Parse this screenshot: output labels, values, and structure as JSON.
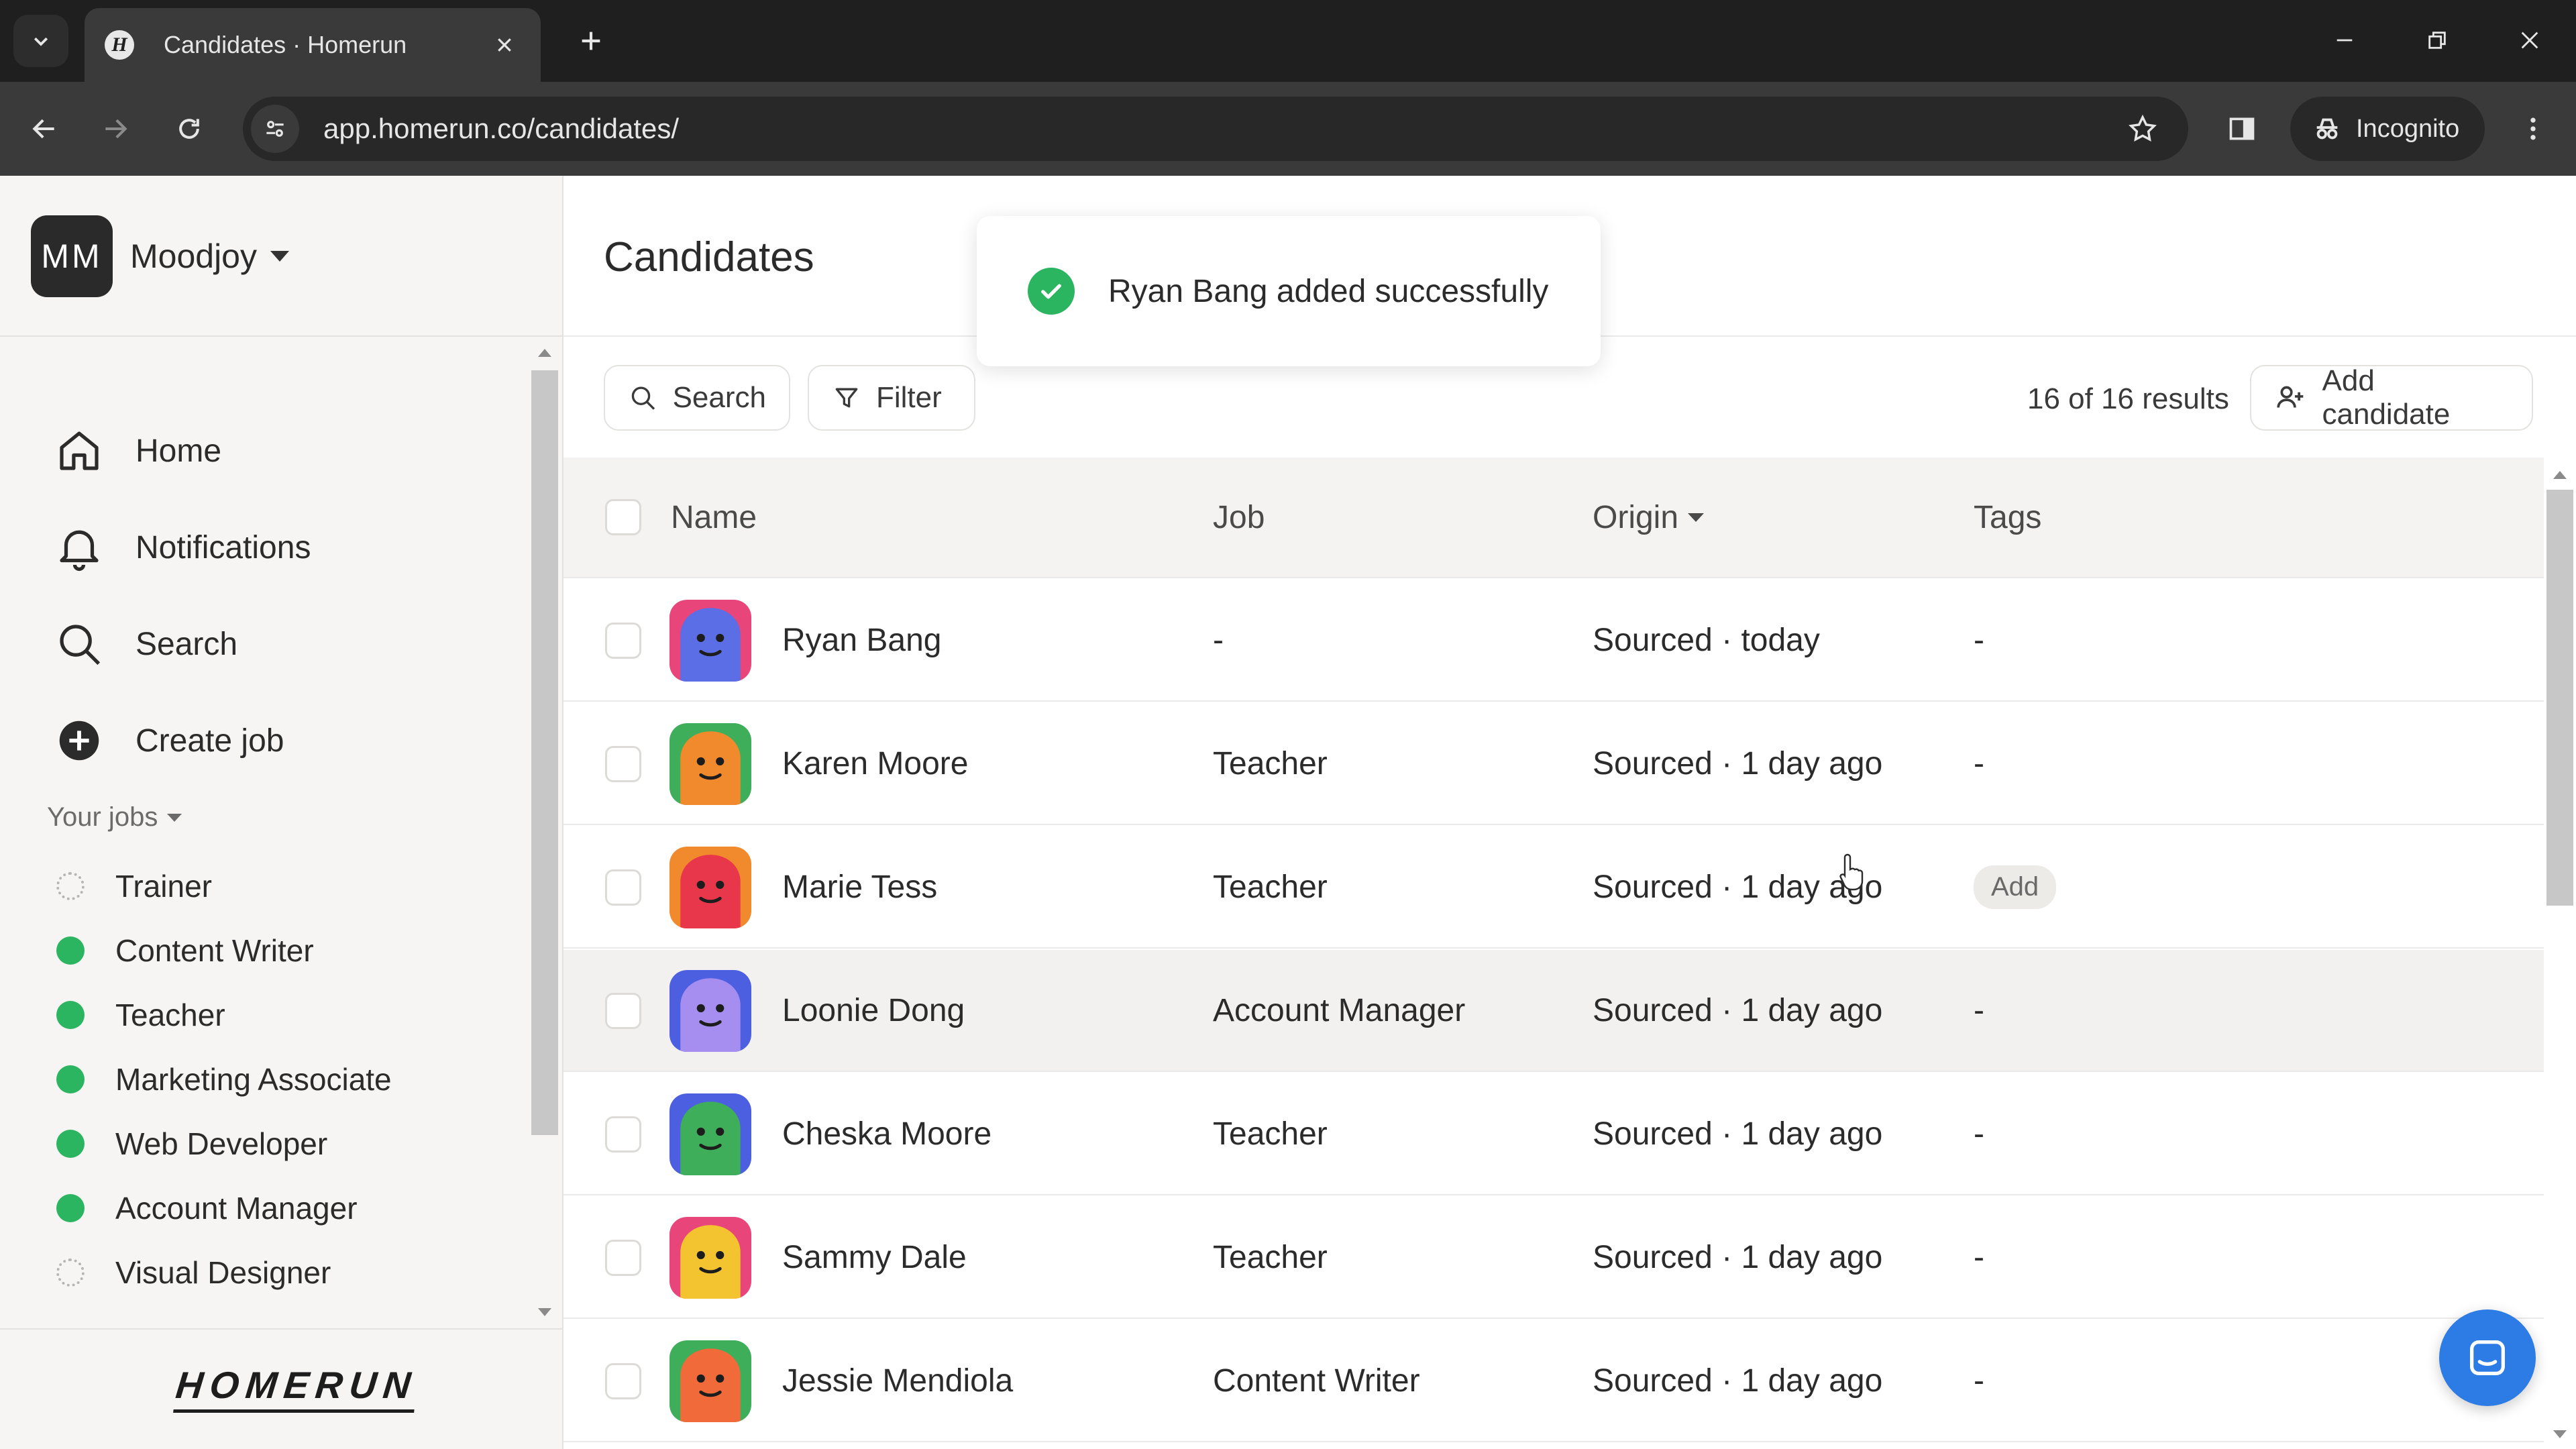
{
  "browser": {
    "tab_title": "Candidates · Homerun",
    "favicon_letter": "H",
    "url": "app.homerun.co/candidates/",
    "incognito_label": "Incognito"
  },
  "sidebar": {
    "org_initials": "MM",
    "org_name": "Moodjoy",
    "nav": [
      {
        "label": "Home",
        "icon": "home-icon"
      },
      {
        "label": "Notifications",
        "icon": "bell-icon"
      },
      {
        "label": "Search",
        "icon": "search-icon"
      },
      {
        "label": "Create job",
        "icon": "plus-circle-icon"
      }
    ],
    "jobs_header": "Your jobs",
    "jobs": [
      {
        "label": "Trainer",
        "status": "draft"
      },
      {
        "label": "Content Writer",
        "status": "published"
      },
      {
        "label": "Teacher",
        "status": "published"
      },
      {
        "label": "Marketing Associate",
        "status": "published"
      },
      {
        "label": "Web Developer",
        "status": "published"
      },
      {
        "label": "Account Manager",
        "status": "published"
      },
      {
        "label": "Visual Designer",
        "status": "draft"
      }
    ],
    "brand": "HOMERUN"
  },
  "main": {
    "title": "Candidates",
    "toast": "Ryan Bang added successfully",
    "search_label": "Search",
    "filter_label": "Filter",
    "results": "16 of 16 results",
    "add_candidate_label": "Add candidate",
    "columns": {
      "name": "Name",
      "job": "Job",
      "origin": "Origin",
      "tags": "Tags"
    },
    "rows": [
      {
        "name": "Ryan Bang",
        "job": "-",
        "origin": "Sourced · today",
        "tags": "-",
        "avatar_bg": "#e8457a",
        "avatar_face": "#5b6ee6"
      },
      {
        "name": "Karen Moore",
        "job": "Teacher",
        "origin": "Sourced · 1 day ago",
        "tags": "-",
        "avatar_bg": "#3fae5a",
        "avatar_face": "#f08a2c"
      },
      {
        "name": "Marie Tess",
        "job": "Teacher",
        "origin": "Sourced · 1 day ago",
        "tags": "Add",
        "avatar_bg": "#f08a2c",
        "avatar_face": "#e8364a"
      },
      {
        "name": "Loonie Dong",
        "job": "Account Manager",
        "origin": "Sourced · 1 day ago",
        "tags": "-",
        "avatar_bg": "#4c5fe0",
        "avatar_face": "#a58ef0"
      },
      {
        "name": "Cheska Moore",
        "job": "Teacher",
        "origin": "Sourced · 1 day ago",
        "tags": "-",
        "avatar_bg": "#4c5fe0",
        "avatar_face": "#3fae5a"
      },
      {
        "name": "Sammy Dale",
        "job": "Teacher",
        "origin": "Sourced · 1 day ago",
        "tags": "-",
        "avatar_bg": "#e8457a",
        "avatar_face": "#f4c430"
      },
      {
        "name": "Jessie Mendiola",
        "job": "Content Writer",
        "origin": "Sourced · 1 day ago",
        "tags": "-",
        "avatar_bg": "#3fae5a",
        "avatar_face": "#f06a3a"
      }
    ]
  },
  "colors": {
    "success": "#2bb560",
    "chat_button": "#2d7be5"
  }
}
